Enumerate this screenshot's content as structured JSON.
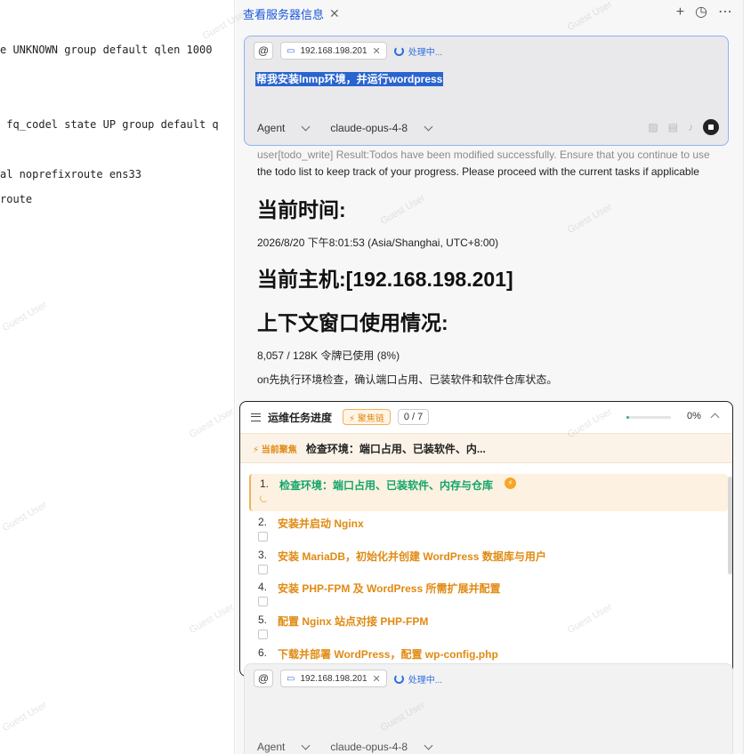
{
  "terminal": {
    "lines": [
      "e UNKNOWN group default qlen 1000",
      " fq_codel state UP group default q",
      "al noprefixroute ens33",
      "route"
    ]
  },
  "tab": {
    "title": "查看服务器信息",
    "close": "✕"
  },
  "tab_actions": {
    "add": "+",
    "history": "◷",
    "more": "⋯"
  },
  "input": {
    "at": "@",
    "host": "192.168.198.201",
    "host_close": "✕",
    "status": "处理中...",
    "selected_text": "帮我安装lnmp环境，并运行wordpress",
    "mode": "Agent",
    "model": "claude-opus-4-8"
  },
  "messages": {
    "tool_result_1": "user[todo_write] Result:Todos have been modified successfully. Ensure that you continue to use",
    "tool_result_2": "the todo list to keep track of your progress. Please proceed with the current tasks if applicable",
    "time_heading": "当前时间:",
    "time_value": "2026/8/20 下午8:01:53 (Asia/Shanghai, UTC+8:00)",
    "host_heading": "当前主机:[192.168.198.201]",
    "context_heading": "上下文窗口使用情况:",
    "context_value": "8,057 / 128K 令牌已使用 (8%)",
    "note": "on先执行环境检查，确认端口占用、已装软件和软件仓库状态。"
  },
  "task_panel": {
    "title": "运维任务进度",
    "focus_badge": "⚡ 聚焦链",
    "count": "0 / 7",
    "progress_fraction": 0.0,
    "percent": "0%",
    "current_focus_label": "⚡ 当前聚焦",
    "current_focus_text": "检查环境：端口占用、已装软件、内...",
    "items": [
      {
        "num": "1.",
        "label": "检查环境：端口占用、已装软件、内存与仓库",
        "status": "active"
      },
      {
        "num": "2.",
        "label": "安装并启动 Nginx",
        "status": "pending"
      },
      {
        "num": "3.",
        "label": "安装 MariaDB，初始化并创建 WordPress 数据库与用户",
        "status": "pending"
      },
      {
        "num": "4.",
        "label": "安装 PHP-FPM 及 WordPress 所需扩展并配置",
        "status": "pending"
      },
      {
        "num": "5.",
        "label": "配置 Nginx 站点对接 PHP-FPM",
        "status": "pending"
      },
      {
        "num": "6.",
        "label": "下载并部署 WordPress，配置 wp-config.php",
        "status": "pending"
      }
    ]
  },
  "input2": {
    "at": "@",
    "host": "192.168.198.201",
    "host_close": "✕",
    "status": "处理中...",
    "mode": "Agent",
    "model": "claude-opus-4-8"
  },
  "watermark": "Guest User",
  "colors": {
    "accent": "#2f6de0",
    "orange": "#e08a12",
    "green": "#12a56b"
  }
}
